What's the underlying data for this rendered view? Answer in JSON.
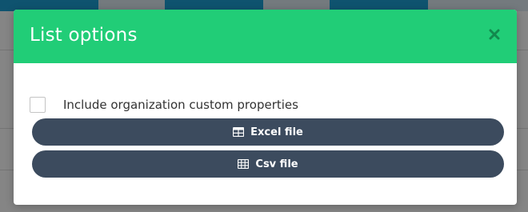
{
  "modal": {
    "title": "List options",
    "close_icon": "close-icon",
    "checkbox": {
      "label": "Include organization custom properties",
      "checked": false
    },
    "buttons": [
      {
        "label": "Excel file",
        "icon": "table-icon"
      },
      {
        "label": "Csv file",
        "icon": "grid-icon"
      }
    ]
  },
  "colors": {
    "header": "#21cd77",
    "button": "#3c4b5e",
    "background_bar": "#1b8fc0"
  }
}
